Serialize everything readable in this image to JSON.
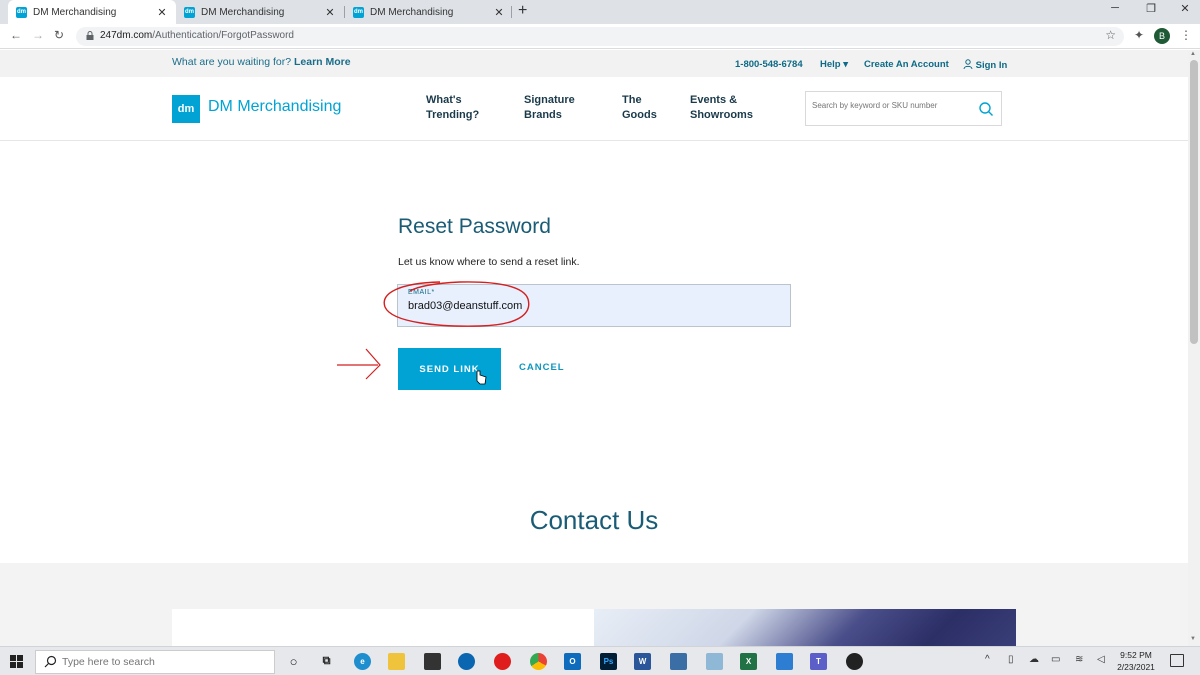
{
  "browser": {
    "tabs": [
      {
        "title": "DM Merchandising",
        "favicon": "dm-favicon-icon"
      },
      {
        "title": "DM Merchandising",
        "favicon": "dm-favicon-icon"
      },
      {
        "title": "DM Merchandising",
        "favicon": "dm-favicon-icon"
      }
    ],
    "url_host": "247dm.com",
    "url_path": "/Authentication/ForgotPassword",
    "profile_initial": "B"
  },
  "topbar": {
    "promo_text": "What are you waiting for?",
    "promo_link": "Learn More",
    "phone": "1-800-548-6784",
    "help": "Help",
    "create_account": "Create An Account",
    "sign_in": "Sign In"
  },
  "header": {
    "logo_mark": "dm",
    "logo_text": "DM Merchandising",
    "nav": [
      {
        "line1": "What's",
        "line2": "Trending?"
      },
      {
        "line1": "Signature",
        "line2": "Brands"
      },
      {
        "line1": "The",
        "line2": "Goods"
      },
      {
        "line1": "Events &",
        "line2": "Showrooms"
      }
    ],
    "search_placeholder": "Search by keyword or SKU number"
  },
  "form": {
    "title": "Reset Password",
    "subtitle": "Let us know where to send a reset link.",
    "email_label": "EMAIL*",
    "email_value": "brad03@deanstuff.com",
    "send_label": "SEND LINK",
    "cancel_label": "CANCEL"
  },
  "contact": {
    "title": "Contact Us"
  },
  "taskbar": {
    "search_placeholder": "Type here to search",
    "time": "9:52 PM",
    "date": "2/23/2021",
    "apps": [
      "cortana-icon",
      "task-view-icon",
      "edge-icon",
      "file-explorer-icon",
      "store-icon",
      "dell-icon",
      "opera-icon",
      "chrome-icon",
      "outlook-icon",
      "photoshop-icon",
      "word-icon",
      "app-icon",
      "app-icon-2",
      "excel-icon",
      "photos-icon",
      "teams-icon",
      "media-icon"
    ],
    "colors": {
      "accent": "#00a3d4",
      "annotation": "#d42020"
    }
  }
}
